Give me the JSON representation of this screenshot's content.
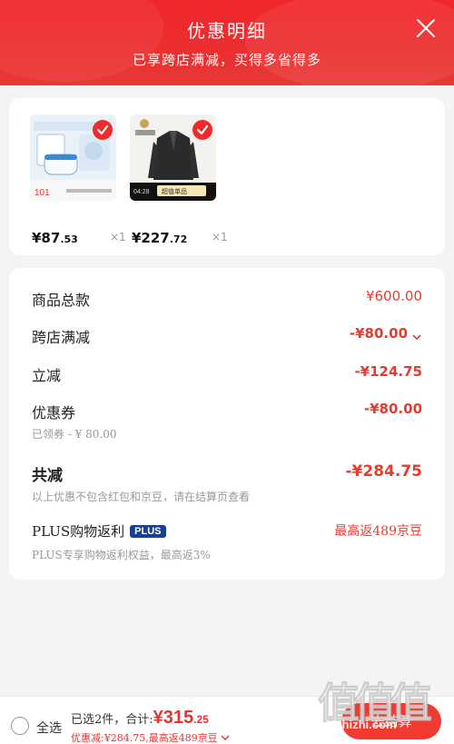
{
  "header": {
    "title": "优惠明细",
    "subtitle": "已享跨店满减，买得多省得多"
  },
  "products": [
    {
      "price_int": "¥87",
      "price_dec": ".53",
      "qty": "×1",
      "image_label": "101"
    },
    {
      "price_int": "¥227",
      "price_dec": ".72",
      "qty": "×1",
      "image_label": "超值单品"
    }
  ],
  "details": {
    "total_label": "商品总款",
    "total_value": "¥600.00",
    "cross_label": "跨店满减",
    "cross_value": "-¥80.00",
    "instant_label": "立减",
    "instant_value": "-¥124.75",
    "coupon_label": "优惠券",
    "coupon_value": "-¥80.00",
    "coupon_sub": "已领券 - ¥ 80.00",
    "sum_label": "共减",
    "sum_value": "-¥284.75",
    "sum_note": "以上优惠不包含红包和京豆，请在结算页查看",
    "plus_label": "PLUS购物返利",
    "plus_badge": "PLUS",
    "plus_value": "最高返489京豆",
    "plus_note": "PLUS专享购物返利权益，最高返3%"
  },
  "bottom": {
    "select_all": "全选",
    "selected_text": "已选2件，合计:",
    "total_big": "¥315",
    "total_cents": ".25",
    "discount_line": "优惠减:¥284.75,最高返489京豆",
    "checkout_label": "去结算"
  },
  "watermark": {
    "text": "值值值",
    "url": "zhizhizhi.com"
  },
  "colors": {
    "accent": "#e63b2e",
    "header": "#f0262b",
    "plus": "#1b3f8f"
  }
}
